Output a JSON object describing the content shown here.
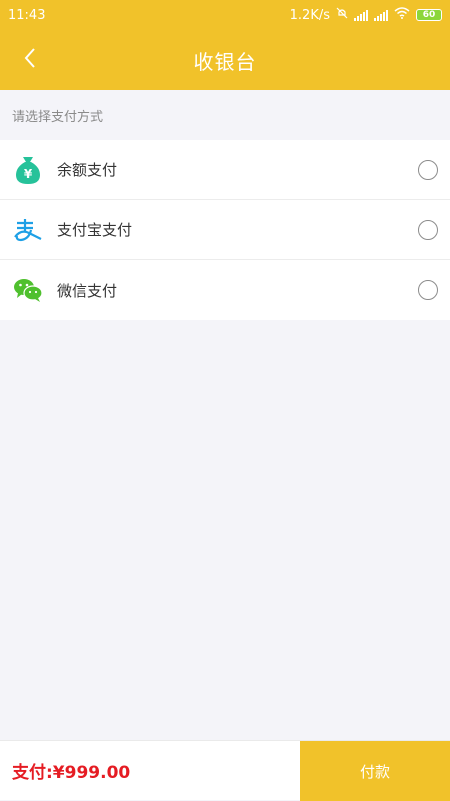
{
  "status_bar": {
    "time": "11:43",
    "network_speed": "1.2K/s",
    "battery": "60",
    "icons": [
      "mute-icon",
      "signal-icon",
      "signal-icon",
      "wifi-icon",
      "battery-icon"
    ]
  },
  "header": {
    "title": "收银台",
    "back_icon": "chevron-left-icon"
  },
  "section": {
    "label": "请选择支付方式"
  },
  "payment_methods": [
    {
      "label": "余额支付",
      "icon": "money-bag-icon",
      "selected": false
    },
    {
      "label": "支付宝支付",
      "icon": "alipay-icon",
      "selected": false
    },
    {
      "label": "微信支付",
      "icon": "wechat-icon",
      "selected": false
    }
  ],
  "footer": {
    "total": "支付:¥999.00",
    "pay_label": "付款"
  },
  "colors": {
    "brand": "#f1c22a",
    "price": "#e51c23",
    "balance_icon": "#26c29a",
    "alipay_icon": "#1ea0e6",
    "wechat_icon": "#4fc02e"
  }
}
